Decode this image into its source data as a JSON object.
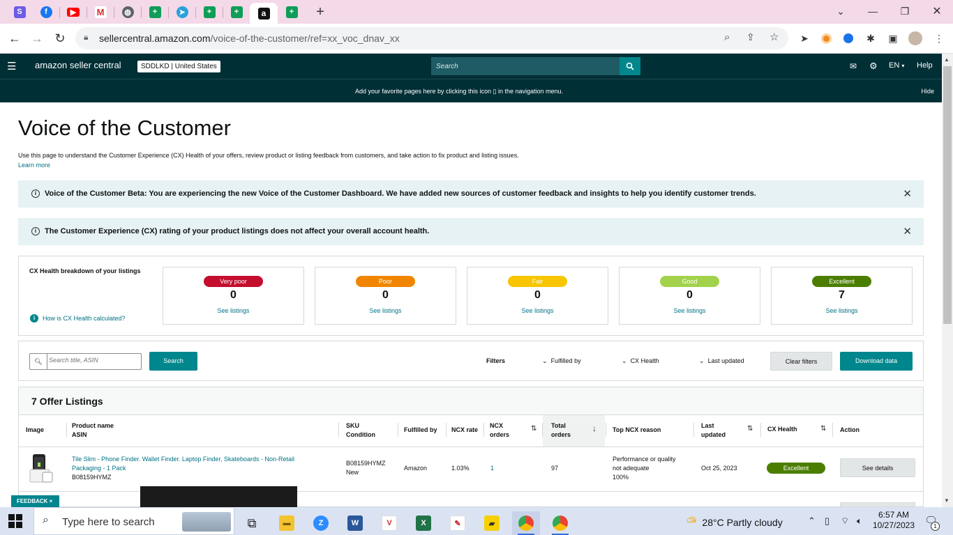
{
  "browser": {
    "url_host": "sellercentral.amazon.com",
    "url_path": "/voice-of-the-customer/ref=xx_voc_dnav_xx",
    "tab_icons": [
      "s-icon",
      "facebook-icon",
      "youtube-icon",
      "gmail-icon",
      "globe-icon",
      "sheets-icon",
      "telegram-icon",
      "sheets-icon",
      "sheets-icon",
      "amazon-icon",
      "sheets-icon"
    ],
    "new_tab": "+"
  },
  "header": {
    "logo": "amazon seller central",
    "account": "SDDLKD | United States",
    "search_placeholder": "Search",
    "language": "EN",
    "help": "Help",
    "favorites_message": "Add your favorite pages here by clicking this icon ▯ in the navigation menu.",
    "hide": "Hide"
  },
  "page": {
    "title": "Voice of the Customer",
    "description": "Use this page to understand the Customer Experience (CX) Health of your offers, review product or listing feedback from customers, and take action to fix product and listing issues.",
    "learn_more": "Learn more"
  },
  "banners": [
    {
      "text": "Voice of the Customer Beta: You are experiencing the new Voice of the Customer Dashboard. We have added new sources of customer feedback and insights to help you identify customer trends."
    },
    {
      "text": "The Customer Experience (CX) rating of your product listings does not affect your overall account health."
    }
  ],
  "cx_health": {
    "title": "CX Health breakdown of your listings",
    "how_link": "How is CX Health calculated?",
    "cards": [
      {
        "label": "Very poor",
        "count": "0",
        "link": "See listings",
        "color": "#c40e2e"
      },
      {
        "label": "Poor",
        "count": "0",
        "link": "See listings",
        "color": "#f28500"
      },
      {
        "label": "Fair",
        "count": "0",
        "link": "See listings",
        "color": "#f7c600"
      },
      {
        "label": "Good",
        "count": "0",
        "link": "See listings",
        "color": "#a2d24c"
      },
      {
        "label": "Excellent",
        "count": "7",
        "link": "See listings",
        "color": "#4b7e00"
      }
    ]
  },
  "search": {
    "placeholder": "Search title, ASIN",
    "button": "Search",
    "filters_label": "Filters",
    "filter_fulfilled": "Fulfilled by",
    "filter_cx": "CX Health",
    "filter_updated": "Last updated",
    "clear": "Clear filters",
    "download": "Download data"
  },
  "listings": {
    "title": "7 Offer Listings",
    "columns": {
      "image": "Image",
      "product": "Product name",
      "asin": "ASIN",
      "sku": "SKU",
      "condition": "Condition",
      "fulfilled": "Fulfilled by",
      "ncx_rate": "NCX rate",
      "ncx_orders_1": "NCX",
      "ncx_orders_2": "orders",
      "total_1": "Total",
      "total_2": "orders",
      "top_reason": "Top NCX reason",
      "last_1": "Last",
      "last_2": "updated",
      "cx_health": "CX Health",
      "action": "Action"
    },
    "rows": [
      {
        "product_1": "Tile Slim - Phone Finder. Wallet Finder. Laptop Finder, Skateboards - Non-Retail",
        "product_2": "Packaging - 1 Pack",
        "asin": "B08159HYMZ",
        "sku": "B08159HYMZ",
        "condition": "New",
        "fulfilled": "Amazon",
        "ncx_rate": "1.03%",
        "ncx_orders": "1",
        "total_orders": "97",
        "reason_1": "Performance or quality",
        "reason_2": "not adequate",
        "reason_3": "100%",
        "last_updated": "Oct 25, 2023",
        "cx_health": "Excellent",
        "action": "See details"
      }
    ]
  },
  "feedback": "FEEDBACK ×",
  "taskbar": {
    "search_placeholder": "Type here to search",
    "weather": "28°C  Partly cloudy",
    "time": "6:57 AM",
    "date": "10/27/2023",
    "notifications": "1"
  }
}
